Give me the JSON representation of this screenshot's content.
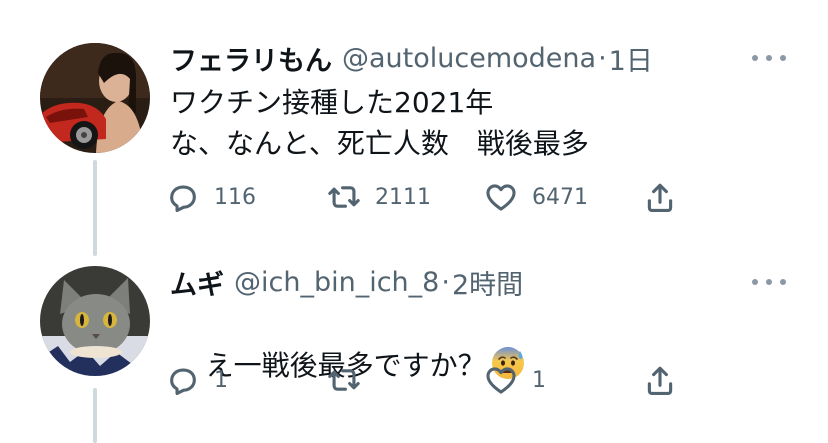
{
  "tweets": [
    {
      "display_name": "フェラリもん",
      "handle": "@autolucemodena",
      "separator": "·",
      "time": "1日",
      "lines": [
        "ワクチン接種した2021年",
        "な、なんと、死亡人数　戦後最多"
      ],
      "reply_count": "116",
      "retweet_count": "2111",
      "like_count": "6471",
      "avatar_icon": "woman-with-red-car-avatar"
    },
    {
      "display_name": "ムギ",
      "handle": "@ich_bin_ich_8",
      "separator": "·",
      "time": "2時間",
      "text": "え一戦後最多ですか？",
      "emoji_icon": "anxious-face-with-sweat-emoji",
      "reply_count": "1",
      "retweet_count": "",
      "like_count": "1",
      "avatar_icon": "gray-cat-avatar"
    }
  ],
  "colors": {
    "thread_line": "#cfd9de",
    "muted_text": "#536471",
    "primary_text": "#0f1419"
  }
}
